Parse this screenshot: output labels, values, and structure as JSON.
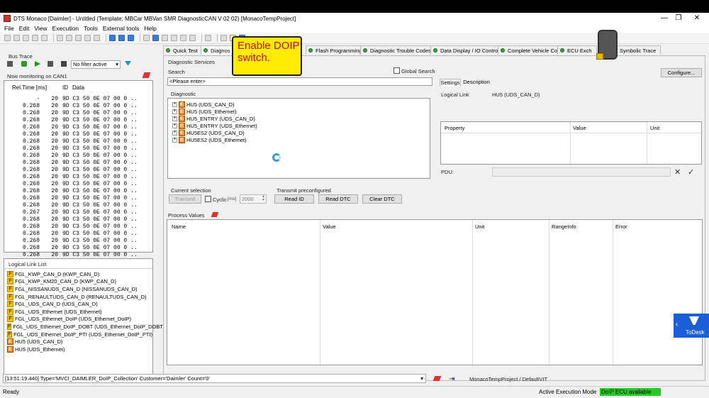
{
  "window": {
    "title": "DTS Monaco [Daimler] - Untitled (Template: MBCar MBVan SMR DiagnosticCAN V 02 02) [MonacoTempProject]"
  },
  "menu": [
    "File",
    "Edit",
    "View",
    "Execution",
    "Tools",
    "External tools",
    "Help"
  ],
  "bus_trace": {
    "title": "Bus Trace",
    "filter": "No filter active",
    "monitoring": "Now monitoring on CAN1",
    "columns": [
      "Rel.Time [ms]",
      "ID",
      "Data"
    ],
    "rows": [
      {
        "t": "-",
        "id": "20",
        "d": "9D C3 50 0E 07 00 0 .."
      },
      {
        "t": "0.268",
        "id": "20",
        "d": "9D C3 50 0E 07 00 0 .."
      },
      {
        "t": "0.268",
        "id": "20",
        "d": "9D C3 50 0E 07 00 0 .."
      },
      {
        "t": "0.268",
        "id": "20",
        "d": "9D C3 50 0E 07 00 0 .."
      },
      {
        "t": "0.268",
        "id": "20",
        "d": "9D C3 50 0E 07 00 0 .."
      },
      {
        "t": "0.268",
        "id": "20",
        "d": "9D C3 50 0E 07 00 0 .."
      },
      {
        "t": "0.268",
        "id": "20",
        "d": "9D C3 50 0E 07 00 0 .."
      },
      {
        "t": "0.268",
        "id": "20",
        "d": "9D C3 50 0E 07 00 0 .."
      },
      {
        "t": "0.268",
        "id": "20",
        "d": "9D C3 50 0E 07 00 0 .."
      },
      {
        "t": "0.268",
        "id": "20",
        "d": "9D C3 50 0E 07 00 0 .."
      },
      {
        "t": "0.268",
        "id": "20",
        "d": "9D C3 50 0E 07 00 0 .."
      },
      {
        "t": "0.268",
        "id": "20",
        "d": "9D C3 50 0E 07 00 0 .."
      },
      {
        "t": "0.268",
        "id": "20",
        "d": "9D C3 50 0E 07 00 0 .."
      },
      {
        "t": "0.268",
        "id": "20",
        "d": "9D C3 50 0E 07 00 0 .."
      },
      {
        "t": "0.268",
        "id": "20",
        "d": "9D C3 50 0E 07 00 0 .."
      },
      {
        "t": "0.268",
        "id": "20",
        "d": "9D C3 50 0E 07 00 0 .."
      },
      {
        "t": "0.267",
        "id": "20",
        "d": "9D C3 50 0E 07 00 0 .."
      },
      {
        "t": "0.268",
        "id": "20",
        "d": "9D C3 50 0E 07 00 0 .."
      },
      {
        "t": "0.268",
        "id": "20",
        "d": "9D C3 50 0E 07 00 0 .."
      },
      {
        "t": "0.268",
        "id": "20",
        "d": "9D C3 50 0E 07 00 0 .."
      },
      {
        "t": "0.268",
        "id": "20",
        "d": "9D C3 50 0E 07 00 0 .."
      },
      {
        "t": "0.268",
        "id": "20",
        "d": "9D C3 50 0E 07 00 0 .."
      },
      {
        "t": "0.268",
        "id": "20",
        "d": "9D C3 50 0E 07 00 0 .."
      },
      {
        "t": "0.268",
        "id": "20",
        "d": "9D C3 50 0E 07 00 0 .."
      }
    ]
  },
  "logical_link_list": {
    "title": "Logical Link List",
    "items": [
      {
        "icon": "F",
        "label": "FGL_KWP_CAN_D (KWP_CAN_D)"
      },
      {
        "icon": "F",
        "label": "FGL_KWP_KM20_CAN_D (KWP_CAN_D)"
      },
      {
        "icon": "F",
        "label": "FGL_NISSANUDS_CAN_D (NISSANUDS_CAN_D)"
      },
      {
        "icon": "F",
        "label": "FGL_RENAULTUDS_CAN_D (RENAULTUDS_CAN_D)"
      },
      {
        "icon": "F",
        "label": "FGL_UDS_CAN_D (UDS_CAN_D)"
      },
      {
        "icon": "F",
        "label": "FGL_UDS_Ethernet (UDS_Ethernet)"
      },
      {
        "icon": "F",
        "label": "FGL_UDS_Ethernet_DoIP (UDS_Ethernet_DoIP)"
      },
      {
        "icon": "F",
        "label": "FGL_UDS_Ethernet_DoIP_DOBT (UDS_Ethernet_DoIP_DOBT)"
      },
      {
        "icon": "F",
        "label": "FGL_UDS_Ethernet_DoIP_PTI (UDS_Ethernet_DoIP_PTI)"
      },
      {
        "icon": "E",
        "label": "HU5 (UDS_CAN_D)"
      },
      {
        "icon": "E",
        "label": "HU5 (UDS_Ethernet)"
      }
    ]
  },
  "tabs": [
    "Quick Test",
    "Diagnos",
    "Flash Programming",
    "Diagnostic Trouble Codes",
    "Data Display / IO Control",
    "Complete Vehicle Coding",
    "ECU Exch",
    "Symbolic Trace"
  ],
  "diag_services": {
    "title": "Diagnostic Services",
    "search_label": "Search",
    "global_search": "Global Search",
    "search_value": "<Please enter>",
    "tree_tab": "Diagnostic",
    "tree": [
      "HU5 (UDS_CAN_D)",
      "HU5 (UDS_Ethernet)",
      "HU5_ENTRY (UDS_CAN_D)",
      "HU5_ENTRY (UDS_Ethernet)",
      "HU5ES2 (UDS_CAN_D)",
      "HU5ES2 (UDS_Ethernet)"
    ]
  },
  "settings": {
    "tabs": [
      "Settings",
      "Description"
    ],
    "configure": "Configure...",
    "logical_link_label": "Logical Link",
    "logical_link_value": "HU5 (UDS_CAN_D)",
    "columns": [
      "Property",
      "Value",
      "Unit"
    ],
    "pdu_label": "PDU:"
  },
  "current_selection": {
    "title": "Current selection",
    "transmit": "Transmit",
    "cyclic": "Cyclic",
    "ms_label": "[ms]",
    "interval": "2000"
  },
  "transmit_preconfigured": {
    "title": "Transmit preconfigured",
    "buttons": [
      "Read ID",
      "Read DTC",
      "Clear DTC"
    ]
  },
  "process_values": {
    "title": "Process Values",
    "columns": [
      "Name",
      "Value",
      "Unit",
      "RangeInfo",
      "Error"
    ]
  },
  "log_line": "[13:51:19.440] Type='MVCI_DAIMLER_DoIP_Collection' Customer='Daimler' Count='0'",
  "project": "MonacoTempProject / DefaultVIT",
  "status": {
    "ready": "Ready",
    "mode_label": "Active Execution Mode",
    "mode_value": "DoIP ECU available"
  },
  "overlay": {
    "tooltip": "Enable DOIP switch.",
    "todesk": "ToDesk"
  },
  "colors": {
    "tooltip_bg": "#ffec00",
    "tooltip_text": "#c8101e",
    "status_green": "#22cc22",
    "todesk": "#1a5fd8",
    "tab_dot": "#2ea52e"
  }
}
